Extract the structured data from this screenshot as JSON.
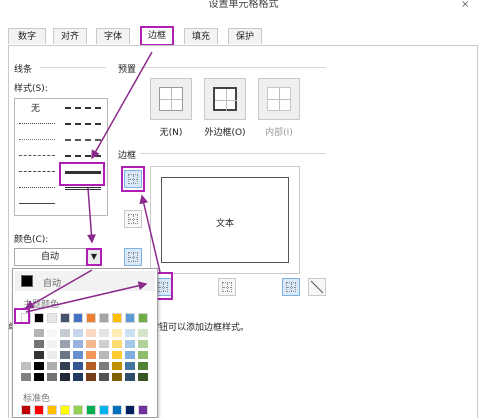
{
  "dialog": {
    "title": "设置单元格格式",
    "close_glyph": "×"
  },
  "tabs": [
    {
      "label": "数字"
    },
    {
      "label": "对齐"
    },
    {
      "label": "字体"
    },
    {
      "label": "边框",
      "active": true
    },
    {
      "label": "填充"
    },
    {
      "label": "保护"
    }
  ],
  "line": {
    "section_label": "线条",
    "style_label": "样式(S):",
    "none_label": "无",
    "color_label": "颜色(C):",
    "color_value": "自动"
  },
  "presets": {
    "section_label": "预置",
    "items": [
      {
        "label": "无(N)"
      },
      {
        "label": "外边框(O)"
      },
      {
        "label": "内部(I)"
      }
    ]
  },
  "border": {
    "section_label": "边框",
    "preview_text": "文本",
    "hint": "按钮可以添加边框样式。",
    "hint_prefix": "单"
  },
  "color_popup": {
    "auto_label": "自动",
    "theme_heading": "主题颜色",
    "standard_heading": "标准色",
    "theme_colors": [
      "#ffffff",
      "#000000",
      "#e7e6e6",
      "#44546a",
      "#4472c4",
      "#ed7d31",
      "#a5a5a5",
      "#ffc000",
      "#5b9bd5",
      "#70ad47"
    ],
    "standard_colors": [
      "#c00000",
      "#ff0000",
      "#ffc000",
      "#ffff00",
      "#92d050",
      "#00b050",
      "#00b0f0",
      "#0070c0",
      "#002060",
      "#7030a0"
    ]
  },
  "accent_colors": {
    "highlight": "#b01fb4"
  }
}
